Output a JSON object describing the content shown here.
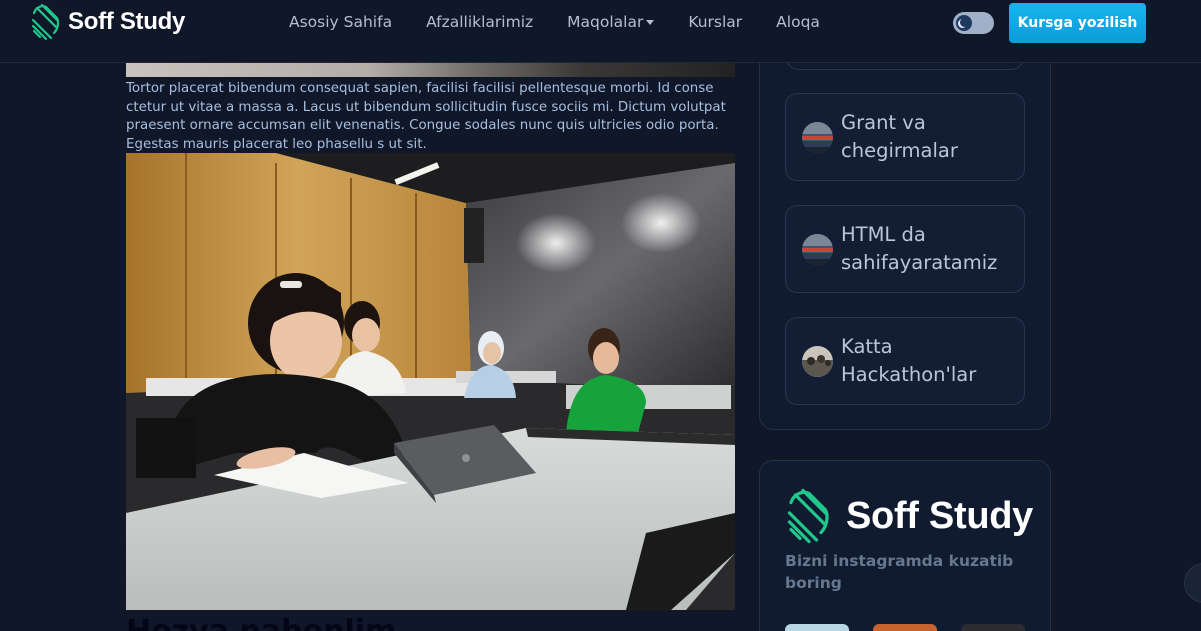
{
  "brand": {
    "name": "Soff Study"
  },
  "nav": {
    "items": [
      "Asosiy Sahifa",
      "Afzalliklarimiz",
      "Maqolalar",
      "Kurslar",
      "Aloqa"
    ],
    "cta_label": "Kursga yozilish"
  },
  "article": {
    "paragraph": "Tortor placerat bibendum consequat sapien, facilisi facilisi pellentesque morbi. Id conse ctetur ut vitae a massa a. Lacus ut bibendum sollicitudin fusce sociis mi. Dictum volutpat praesent ornare accumsan elit venenatis. Congue sodales nunc quis ultricies odio porta. Egestas mauris placerat leo phasellu s ut sit.",
    "next_heading": "Hozva nabonlim"
  },
  "sidebar": {
    "posts": [
      {
        "title": "Grant va chegirmalar",
        "icon": "group-photo-thumbnail"
      },
      {
        "title": "HTML da sahifayaratamiz",
        "icon": "group-photo-thumbnail"
      },
      {
        "title": "Katta Hackathon'lar",
        "icon": "hackathon-thumbnail"
      }
    ],
    "instagram": {
      "brand": "Soff Study",
      "text": "Bizni instagramda kuzatib boring"
    }
  },
  "colors": {
    "background": "#0f1729",
    "accent": "#0ea5e9",
    "logo_green": "#22c58a"
  }
}
